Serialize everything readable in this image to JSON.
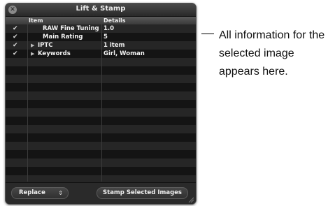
{
  "window": {
    "title": "Lift & Stamp"
  },
  "table": {
    "headers": {
      "item": "Item",
      "details": "Details"
    },
    "rows": [
      {
        "checked": true,
        "expandable": false,
        "item": "RAW Fine Tuning",
        "details": "1.0"
      },
      {
        "checked": true,
        "expandable": false,
        "item": "Main Rating",
        "details": "5"
      },
      {
        "checked": true,
        "expandable": true,
        "item": "IPTC",
        "details": "1 item"
      },
      {
        "checked": true,
        "expandable": true,
        "item": "Keywords",
        "details": "Girl, Woman"
      }
    ],
    "empty_rows": 16
  },
  "footer": {
    "mode_popup": "Replace",
    "stamp_button": "Stamp Selected Images"
  },
  "callout": {
    "text": "All information for the selected image appears here."
  },
  "icons": {
    "close": "close-icon",
    "check": "checkmark-icon",
    "disclosure": "disclosure-triangle-icon",
    "popup_arrows": "up-down-arrows-icon",
    "resize": "resize-grip-icon"
  },
  "colors": {
    "panel_bg": "#1e1e1e",
    "row_light": "#262626",
    "row_dark": "#141414",
    "text": "#f2f2f2"
  }
}
